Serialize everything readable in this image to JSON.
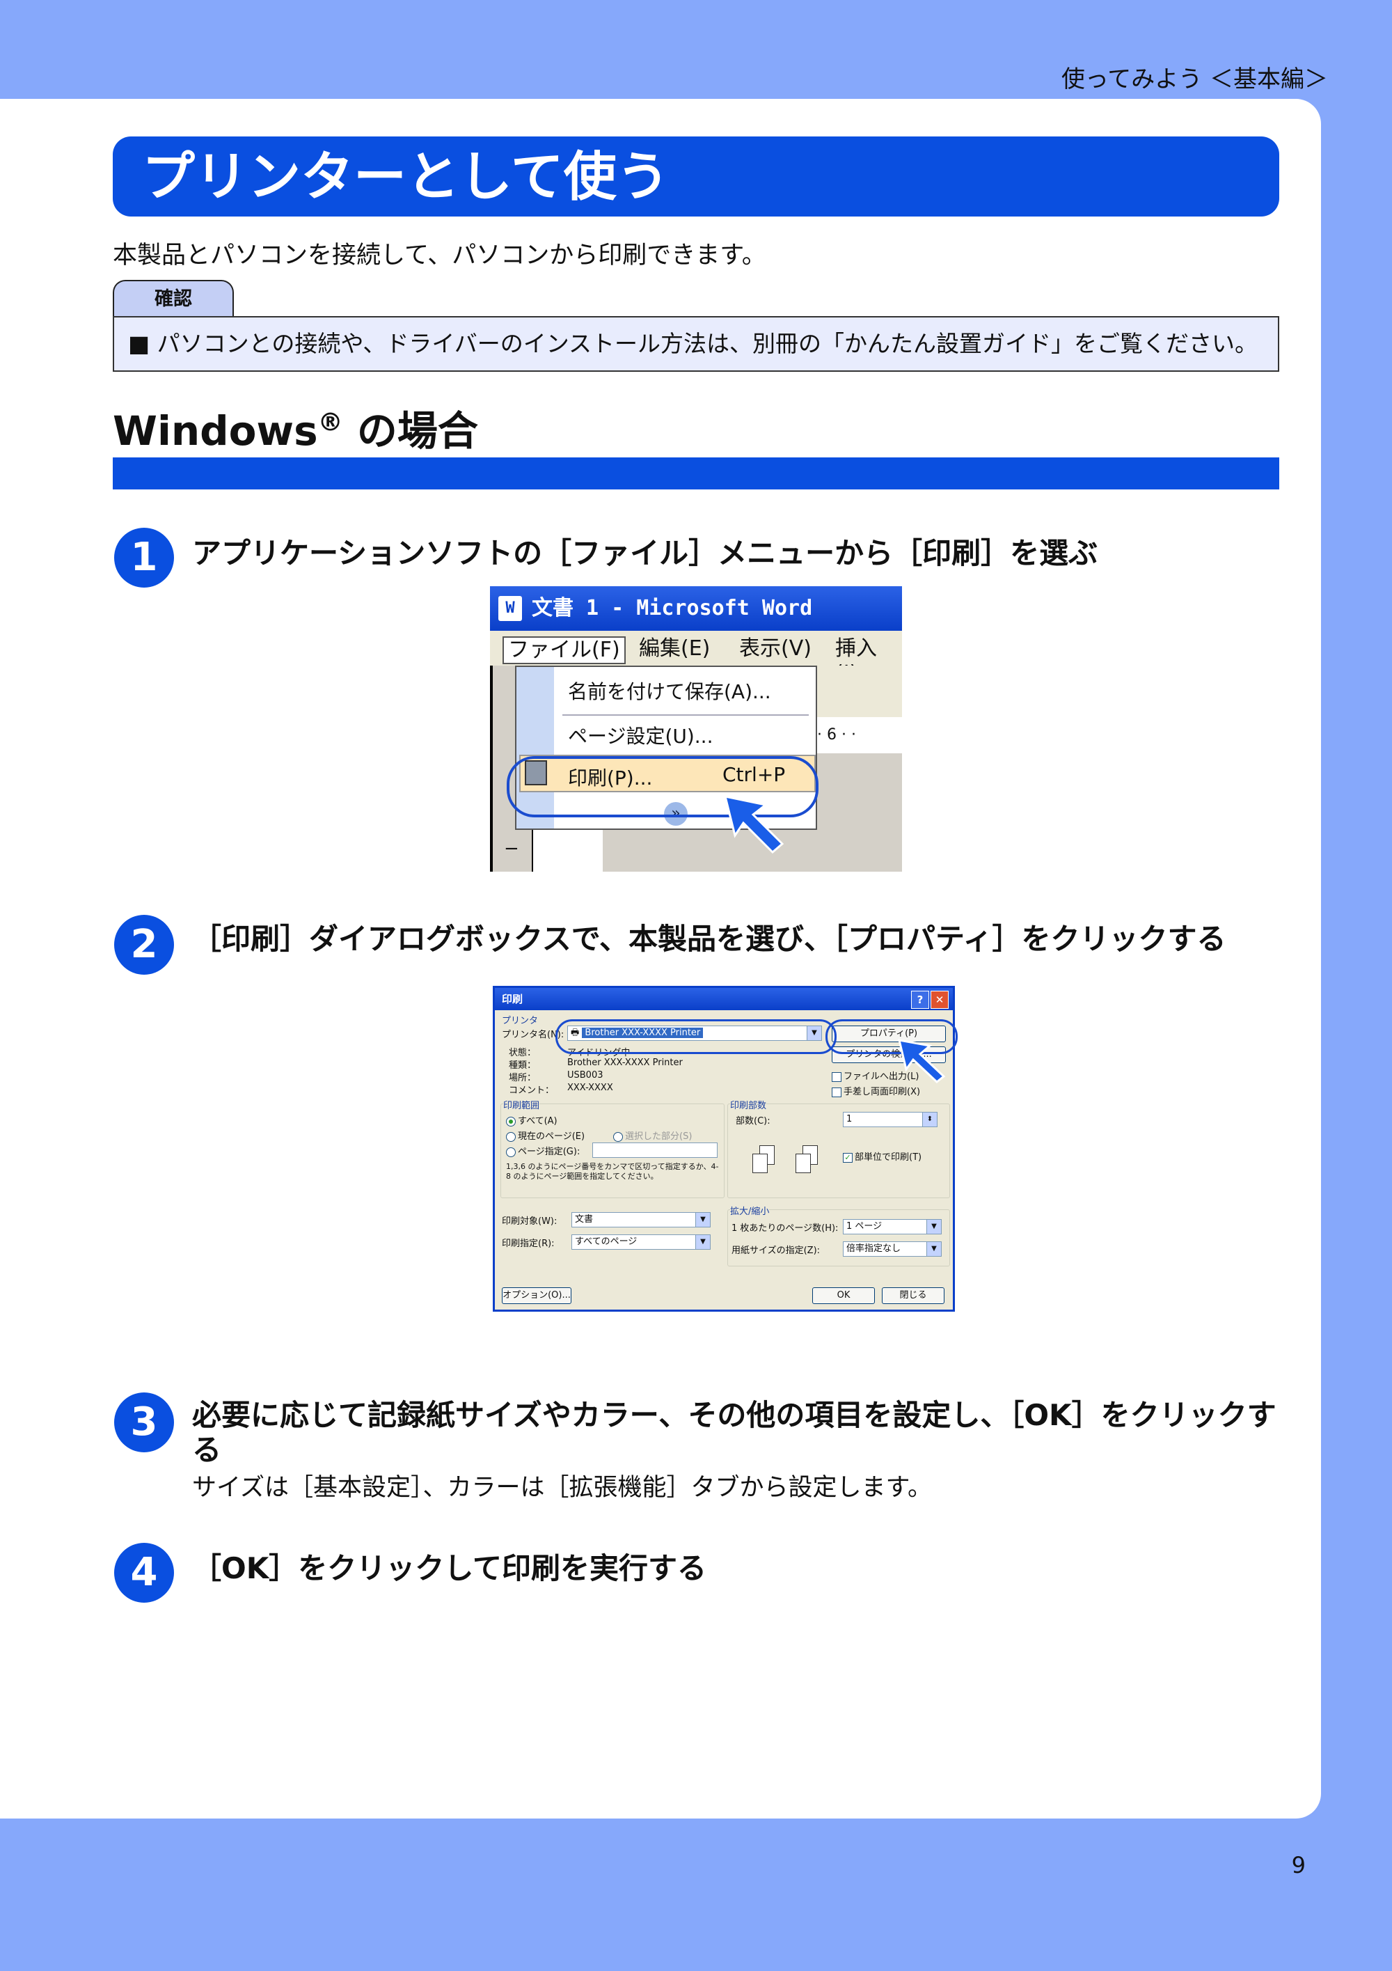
{
  "header": {
    "section_label": "使ってみよう ＜基本編＞"
  },
  "title": "プリンターとして使う",
  "intro": "本製品とパソコンを接続して、パソコンから印刷できます。",
  "note": {
    "tab_label": "確認",
    "text": "■ パソコンとの接続や、ドライバーのインストール方法は、別冊の「かんたん設置ガイド」をご覧ください。"
  },
  "section": {
    "heading": "Windows",
    "heading_mark": "®",
    "heading_suffix": " の場合"
  },
  "steps": [
    {
      "num": "1",
      "title": "アプリケーションソフトの［ファイル］メニューから［印刷］を選ぶ"
    },
    {
      "num": "2",
      "title": "［印刷］ダイアログボックスで、本製品を選び、［プロパティ］をクリックする"
    },
    {
      "num": "3",
      "title": "必要に応じて記録紙サイズやカラー、その他の項目を設定し、［OK］をクリックする",
      "desc": "サイズは［基本設定］、カラーは［拡張機能］タブから設定します。"
    },
    {
      "num": "4",
      "title": "［OK］をクリックして印刷を実行する"
    }
  ],
  "word_screenshot": {
    "window_title": "文書 1 - Microsoft Word",
    "icon_label": "W",
    "menu": [
      "ファイル(F)",
      "編集(E)",
      "表示(V)",
      "挿入(I)"
    ],
    "file_menu_items": [
      {
        "label": "名前を付けて保存(A)...",
        "shortcut": ""
      },
      {
        "label": "ページ設定(U)...",
        "shortcut": ""
      },
      {
        "label": "印刷(P)...",
        "shortcut": "Ctrl+P"
      }
    ],
    "expand_glyph": "»",
    "ruler_text": "· 6 ·  ·",
    "dash": "−"
  },
  "print_dialog": {
    "title": "印刷",
    "help_btn": "?",
    "close_btn": "✕",
    "printer_group": "プリンタ",
    "printer_name_label": "プリンタ名(N):",
    "printer_name_value": "Brother XXX-XXXX Printer",
    "properties_btn": "プロパティ(P)",
    "find_printer_btn": "プリンタの検索(D)...",
    "status_label": "状態：",
    "status_value": "アイドリング中",
    "type_label": "種類：",
    "type_value": "Brother XXX-XXXX Printer",
    "location_label": "場所：",
    "location_value": "USB003",
    "comment_label": "コメント：",
    "comment_value": "XXX-XXXX",
    "print_to_file": "ファイルへ出力(L)",
    "manual_duplex": "手差し両面印刷(X)",
    "range_group": "印刷範囲",
    "range_all": "すべて(A)",
    "range_current": "現在のページ(E)",
    "range_selection": "選択した部分(S)",
    "range_pages": "ページ指定(G):",
    "range_hint": "1,3,6 のようにページ番号をカンマで区切って指定するか、4-8 のようにページ範囲を指定してください。",
    "copies_group": "印刷部数",
    "copies_label": "部数(C):",
    "copies_value": "1",
    "collate": "部単位で印刷(T)",
    "print_what_label": "印刷対象(W):",
    "print_what_value": "文書",
    "print_label": "印刷指定(R):",
    "print_value": "すべてのページ",
    "zoom_group": "拡大/縮小",
    "pages_per_sheet_label": "1 枚あたりのページ数(H):",
    "pages_per_sheet_value": "1 ページ",
    "scale_label": "用紙サイズの指定(Z):",
    "scale_value": "倍率指定なし",
    "options_btn": "オプション(O)...",
    "ok_btn": "OK",
    "close_label_btn": "閉じる",
    "spin_glyph": "⬍",
    "dropdown_glyph": "▼",
    "check_glyph": "✓",
    "printer_icon": "🖶"
  },
  "page_number": "9",
  "colors": {
    "accent": "#0a4fe0",
    "background": "#86a8fb",
    "note_bg": "#e8ecfd"
  }
}
